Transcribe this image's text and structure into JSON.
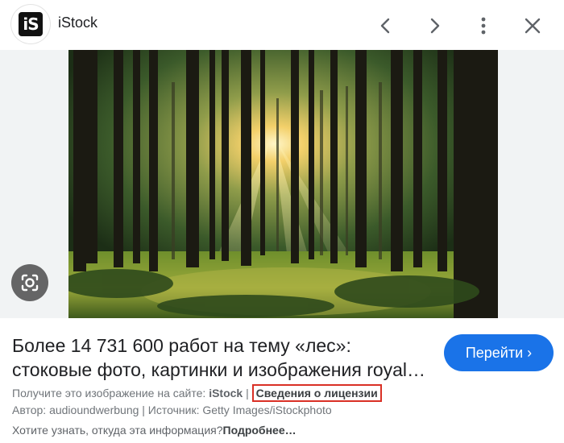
{
  "header": {
    "site_name": "iStock",
    "logo_text": "iS",
    "icons": [
      "chevron-left-icon",
      "chevron-right-icon",
      "more-vert-icon",
      "close-icon"
    ]
  },
  "image": {
    "description_icon": "lens-icon"
  },
  "result": {
    "title_line1": "Более 14 731 600 работ на тему «лес»:",
    "title_line2": "стоковые фото, картинки и изображения royal…",
    "go_button": "Перейти ›",
    "source_prefix": "Получите это изображение на сайте:",
    "source_name": "iStock",
    "separator": "|",
    "license_link": "Сведения о лицензии",
    "author_line": "Автор: audioundwerbung | Источник: Getty Images/iStockphoto",
    "info_question": "Хотите узнать, откуда эта информация?",
    "info_more": "Подробнее…"
  },
  "colors": {
    "accent": "#1a73e8",
    "license_outline": "#d93025"
  }
}
